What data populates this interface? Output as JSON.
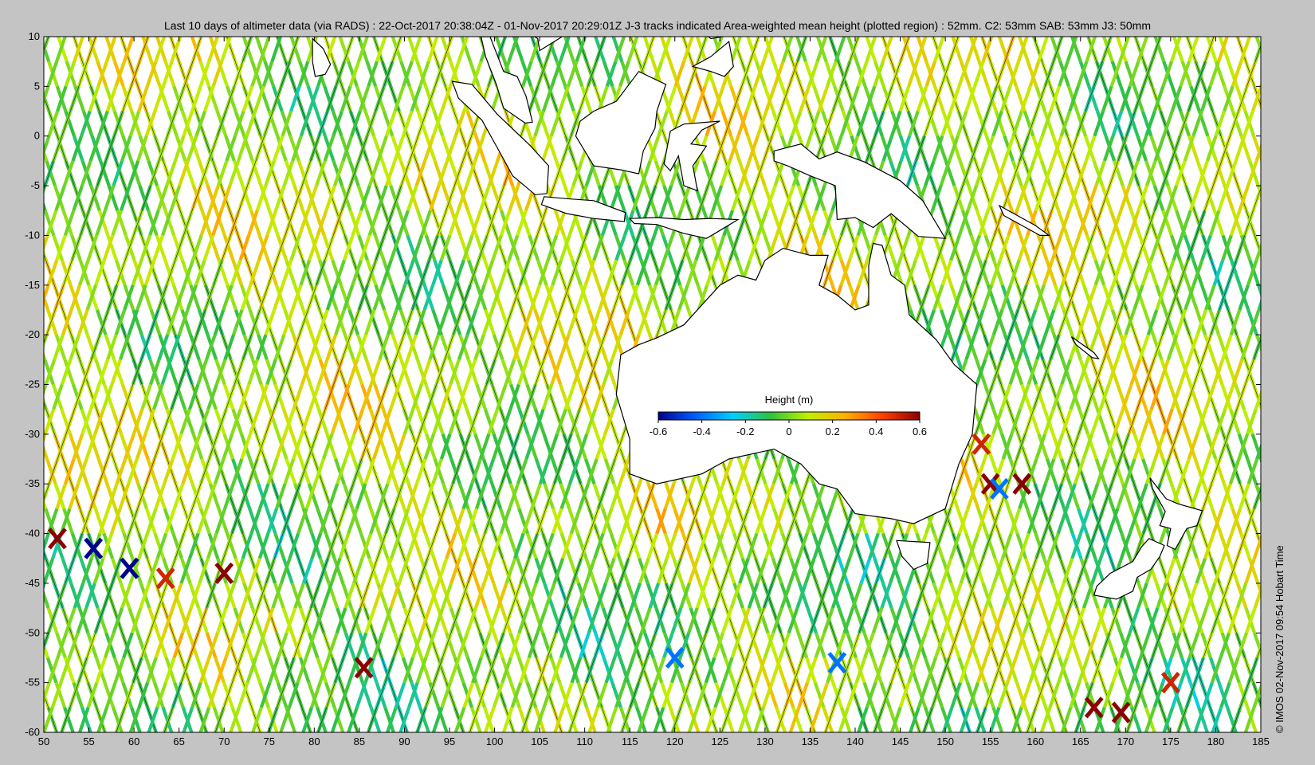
{
  "title": "Last 10 days of altimeter data (via RADS) : 22-Oct-2017 20:38:04Z - 01-Nov-2017 20:29:01Z  J-3 tracks indicated  Area-weighted mean height (plotted region) : 52mm.  C2: 53mm  SAB: 53mm  J3: 50mm",
  "credit": "© IMOS 02-Nov-2017 09:54 Hobart Time",
  "colorbar": {
    "title": "Height (m)",
    "range": [
      -0.6,
      0.6
    ],
    "ticks": [
      "-0.6",
      "-0.4",
      "-0.2",
      "0",
      "0.2",
      "0.4",
      "0.6"
    ],
    "colors": [
      "#00008f",
      "#0060ff",
      "#00d0ff",
      "#30c040",
      "#c0f000",
      "#ffb000",
      "#ff4000",
      "#8b0000"
    ]
  },
  "axes": {
    "x_range": [
      50,
      185
    ],
    "y_range": [
      -60,
      10
    ],
    "x_ticks": [
      "50",
      "55",
      "60",
      "65",
      "70",
      "75",
      "80",
      "85",
      "90",
      "95",
      "100",
      "105",
      "110",
      "115",
      "120",
      "125",
      "130",
      "135",
      "140",
      "145",
      "150",
      "155",
      "160",
      "165",
      "170",
      "175",
      "180",
      "185"
    ],
    "y_ticks": [
      "10",
      "5",
      "0",
      "-5",
      "-10",
      "-15",
      "-20",
      "-25",
      "-30",
      "-35",
      "-40",
      "-45",
      "-50",
      "-55",
      "-60"
    ]
  },
  "anomalies": [
    {
      "lon": 51.5,
      "lat": -40.5,
      "value": 0.6
    },
    {
      "lon": 55.5,
      "lat": -41.5,
      "value": -0.6
    },
    {
      "lon": 59.5,
      "lat": -43.5,
      "value": -0.6
    },
    {
      "lon": 63.5,
      "lat": -44.5,
      "value": 0.5
    },
    {
      "lon": 70.0,
      "lat": -44.0,
      "value": 0.6
    },
    {
      "lon": 85.5,
      "lat": -53.5,
      "value": 0.6
    },
    {
      "lon": 155.0,
      "lat": -35.0,
      "value": 0.6
    },
    {
      "lon": 158.5,
      "lat": -35.0,
      "value": 0.6
    },
    {
      "lon": 154.0,
      "lat": -31.0,
      "value": 0.5
    },
    {
      "lon": 156.0,
      "lat": -35.5,
      "value": -0.4
    },
    {
      "lon": 166.5,
      "lat": -57.5,
      "value": 0.6
    },
    {
      "lon": 169.5,
      "lat": -58.0,
      "value": 0.6
    },
    {
      "lon": 175.0,
      "lat": -55.0,
      "value": 0.5
    },
    {
      "lon": 120.0,
      "lat": -52.5,
      "value": -0.4
    },
    {
      "lon": 138.0,
      "lat": -53.0,
      "value": -0.4
    }
  ]
}
